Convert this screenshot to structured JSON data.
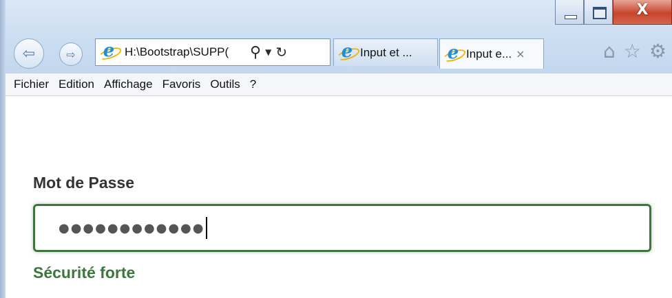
{
  "browser": {
    "address": "H:\\Bootstrap\\SUPP(",
    "tabs": [
      {
        "label": "Input et ..."
      },
      {
        "label": "Input e..."
      }
    ],
    "tab_close_glyph": "×",
    "caption_close": "X"
  },
  "menu": [
    "Fichier",
    "Edition",
    "Affichage",
    "Favoris",
    "Outils",
    "?"
  ],
  "form": {
    "label": "Mot de Passe",
    "password_value": "●●●●●●●●●●●●",
    "help_text": "Sécurité forte",
    "state_color": "#3c763d"
  },
  "icons": {
    "back": "back-arrow-icon",
    "forward": "forward-arrow-icon",
    "search": "search-icon",
    "dropdown": "dropdown-icon",
    "refresh": "refresh-icon",
    "home": "home-icon",
    "favorites": "star-icon",
    "settings": "gear-icon"
  }
}
